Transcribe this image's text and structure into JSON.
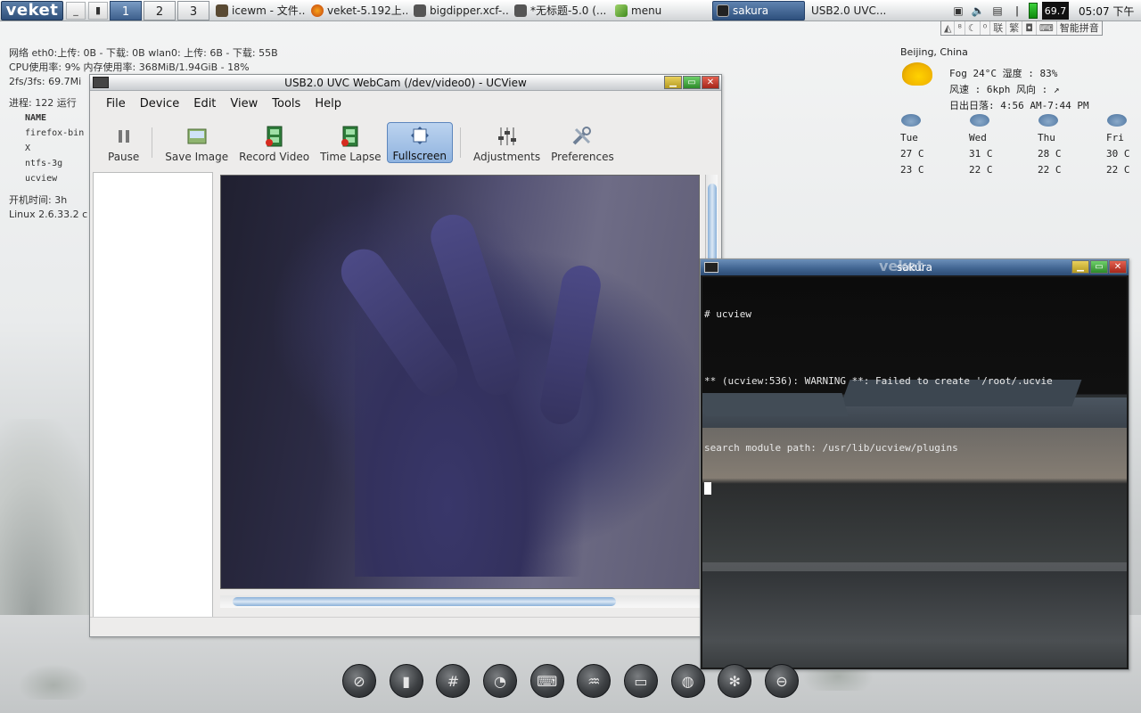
{
  "taskbar": {
    "start_label": "veket",
    "workspaces": [
      "1",
      "2",
      "3"
    ],
    "tasks": [
      {
        "label": "icewm - 文件...",
        "icon": "folder-icon"
      },
      {
        "label": "veket-5.192上...",
        "icon": "firefox-icon"
      },
      {
        "label": "bigdipper.xcf-...",
        "icon": "gimp-icon"
      },
      {
        "label": "*无标题-5.0 (...",
        "icon": "gimp-icon"
      },
      {
        "label": "menu",
        "icon": "leaf-icon"
      },
      {
        "label": "sakura",
        "icon": "terminal-icon",
        "active": true
      },
      {
        "label": "USB2.0 UVC...",
        "icon": ""
      }
    ],
    "cpu_value": "69.7",
    "clock": "05:07 下午"
  },
  "ime": {
    "items": [
      "联",
      "繁",
      "智能拼音"
    ]
  },
  "sysinfo": {
    "net_line": "网络 eth0:上传: 0B   - 下载: 0B    wlan0: 上传: 6B    - 下载: 55B",
    "cpu_line": "CPU使用率: 9% 内存使用率: 368MiB/1.94GiB - 18%",
    "fs_line": "2fs/3fs: 69.7Mi",
    "proc_line": "进程: 122   运行",
    "proc_header": "NAME",
    "procs": [
      "firefox-bin",
      "X",
      "ntfs-3g",
      "ucview"
    ],
    "uptime_line": "开机时间:    3h",
    "kernel_line": "Linux 2.6.33.2 c"
  },
  "weather": {
    "city": "Beijing, China",
    "current": "Fog  24°C  湿度 : 83%",
    "wind": "风速 : 6kph  风向 : ↗",
    "sun": "日出日落: 4:56 AM-7:44 PM",
    "forecast": [
      {
        "day": "Tue",
        "high": "27 C",
        "low": "23 C"
      },
      {
        "day": "Wed",
        "high": "31 C",
        "low": "22 C"
      },
      {
        "day": "Thu",
        "high": "28 C",
        "low": "22 C"
      },
      {
        "day": "Fri",
        "high": "30 C",
        "low": "22 C"
      }
    ]
  },
  "ucview": {
    "title": "USB2.0 UVC WebCam (/dev/video0) - UCView",
    "menus": [
      "File",
      "Device",
      "Edit",
      "View",
      "Tools",
      "Help"
    ],
    "tools": [
      {
        "label": "Pause",
        "name": "pause-button"
      },
      {
        "label": "Save Image",
        "name": "save-image-button"
      },
      {
        "label": "Record Video",
        "name": "record-video-button"
      },
      {
        "label": "Time Lapse",
        "name": "time-lapse-button"
      },
      {
        "label": "Fullscreen",
        "name": "fullscreen-button"
      },
      {
        "label": "Adjustments",
        "name": "adjustments-button"
      },
      {
        "label": "Preferences",
        "name": "preferences-button"
      }
    ]
  },
  "terminal": {
    "title": "sakura",
    "brand": "veket",
    "lines": [
      "# ucview",
      "",
      "** (ucview:536): WARNING **: Failed to create '/root/.ucvie",
      "",
      "search module path: /usr/lib/ucview/plugins"
    ]
  },
  "dock": {
    "items": [
      "system-icon",
      "usb-icon",
      "hash-icon",
      "firefox-icon",
      "keyboard-icon",
      "chart-icon",
      "disk-icon",
      "settings-icon",
      "gear-icon",
      "power-icon"
    ]
  }
}
